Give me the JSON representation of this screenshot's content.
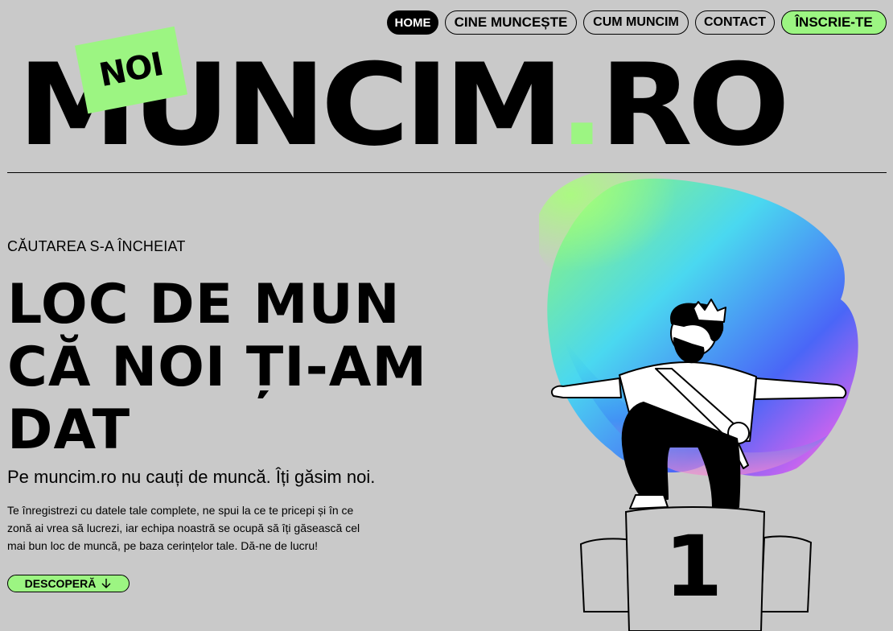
{
  "nav": {
    "home": "HOME",
    "cine": "CINE MUNCEȘTE",
    "cum": "CUM MUNCIM",
    "contact": "CONTACT",
    "inscrie": "ÎNSCRIE-TE"
  },
  "logo": {
    "badge": "NOI",
    "main": "MUNCIM",
    "dot": ".",
    "tld": "RO"
  },
  "hero": {
    "kicker": "CĂUTAREA S-A ÎNCHEIAT",
    "headline_line1": "LOC DE MUN",
    "headline_line2": "CĂ NOI ȚI-AM",
    "headline_line3": "DAT",
    "subtitle": "Pe muncim.ro nu cauți de muncă. Îți găsim noi.",
    "body_line1": "Te înregistrezi cu datele tale complete, ne spui la ce te pricepi și în ce",
    "body_line2": "zonă ai vrea să lucrezi, iar echipa noastră se ocupă să îți găsească cel",
    "body_line3": "mai bun loc de muncă, pe baza cerințelor tale. Dă-ne de lucru!",
    "cta": "DESCOPERĂ"
  },
  "illustration": {
    "podium_number": "1"
  },
  "colors": {
    "background": "#c9c9c9",
    "accent_green": "#9cf582",
    "ink": "#000000"
  },
  "icons": {
    "cta_icon": "arrow-down-icon"
  }
}
